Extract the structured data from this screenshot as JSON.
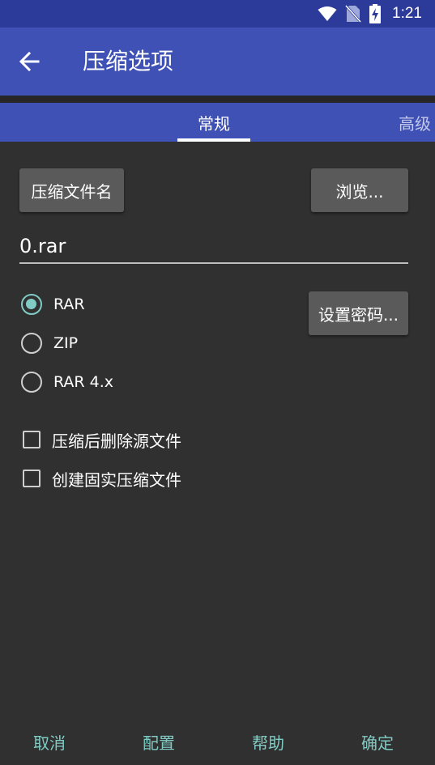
{
  "status_bar": {
    "time": "1:21"
  },
  "app_bar": {
    "title": "压缩选项"
  },
  "tabs": [
    {
      "label": "常规",
      "selected": true
    },
    {
      "label": "高级",
      "selected": false
    }
  ],
  "archive": {
    "name_button": "压缩文件名",
    "browse_button": "浏览...",
    "filename_value": "0.rar",
    "password_button": "设置密码..."
  },
  "formats": [
    {
      "label": "RAR",
      "checked": true
    },
    {
      "label": "ZIP",
      "checked": false
    },
    {
      "label": "RAR 4.x",
      "checked": false
    }
  ],
  "options": [
    {
      "label": "压缩后删除源文件",
      "checked": false
    },
    {
      "label": "创建固实压缩文件",
      "checked": false
    }
  ],
  "footer": {
    "cancel": "取消",
    "config": "配置",
    "help": "帮助",
    "ok": "确定"
  },
  "colors": {
    "primary": "#3f51b5",
    "primary_dark": "#2c3a9a",
    "accent": "#80cbc4",
    "background": "#303030"
  }
}
